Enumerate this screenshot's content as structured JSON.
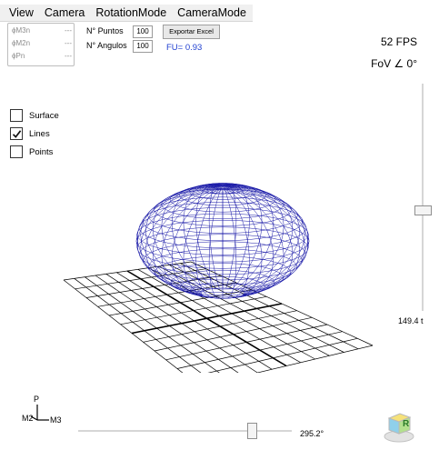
{
  "menu": [
    "View",
    "Camera",
    "RotationMode",
    "CameraMode"
  ],
  "results": [
    {
      "label": "ϕM3n",
      "value": "---"
    },
    {
      "label": "ϕM2n",
      "value": "---"
    },
    {
      "label": "ϕPn",
      "value": "---"
    }
  ],
  "params": {
    "puntos_label": "N° Puntos",
    "puntos_value": "100",
    "angulos_label": "N° Angulos",
    "angulos_value": "100"
  },
  "export_button": "Exportar Excel",
  "fu_text": "FU= 0.93",
  "fps_text": "52 FPS",
  "fov_text": "FoV ∠ 0°",
  "options": [
    {
      "label": "Surface",
      "checked": false
    },
    {
      "label": "Lines",
      "checked": true
    },
    {
      "label": "Points",
      "checked": false
    }
  ],
  "vertical_slider_value": "149.4 t",
  "horizontal_slider_value": "295.2°",
  "axis_labels": {
    "p": "P",
    "m2": "M2",
    "m3": "M3"
  },
  "cube_label": "R",
  "colors": {
    "mesh": "#1a1aa8",
    "grid": "#000000",
    "fu": "#1f3fd0"
  }
}
